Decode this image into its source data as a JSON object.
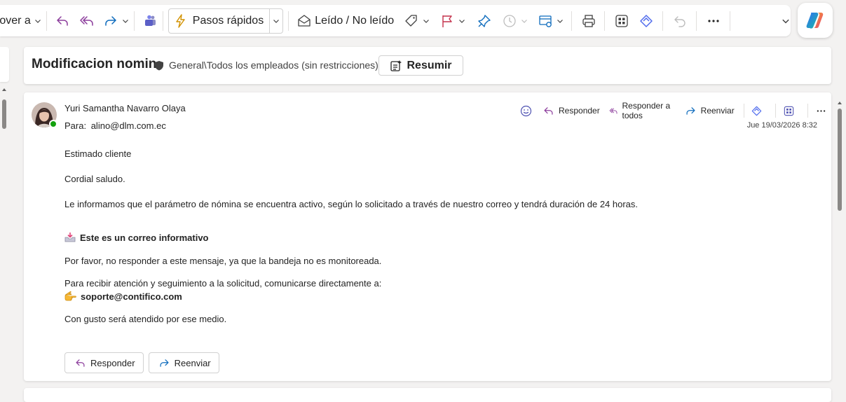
{
  "ribbon": {
    "move_label": "Mover a",
    "quick_steps_label": "Pasos rápidos",
    "read_unread_label": "Leído / No leído"
  },
  "subject": {
    "title": "Modificacion nomin",
    "sensitivity": "General\\Todos los empleados (sin restricciones)",
    "summarize_label": "Resumir"
  },
  "message": {
    "sender": "Yuri Samantha Navarro Olaya",
    "to_label": "Para:",
    "to_address": "alino@dlm.com.ec",
    "date": "Jue 19/03/2026 8:32",
    "actions": {
      "reply": "Responder",
      "reply_all": "Responder a todos",
      "forward": "Reenviar"
    },
    "body": {
      "greeting": "Estimado cliente",
      "salutation": "Cordial saludo.",
      "para1": "Le informamos que el parámetro de nómina se encuentra activo, según lo solicitado a través de nuestro correo y tendrá duración de 24 horas.",
      "info_heading": "Este es un correo informativo",
      "para2": "Por favor, no responder a este mensaje, ya que la bandeja no es monitoreada.",
      "para3": "Para recibir atención y seguimiento a la solicitud, comunicarse directamente a:",
      "support_email": "soporte@contifico.com",
      "closing": "Con gusto será atendido por ese medio."
    },
    "bottom_buttons": {
      "reply": "Responder",
      "forward": "Reenviar"
    }
  },
  "colors": {
    "accent": "#0f6cbd",
    "reply_purple": "#8c3d9c",
    "flag_red": "#c4314b",
    "quick_steps_gold": "#d29200"
  }
}
